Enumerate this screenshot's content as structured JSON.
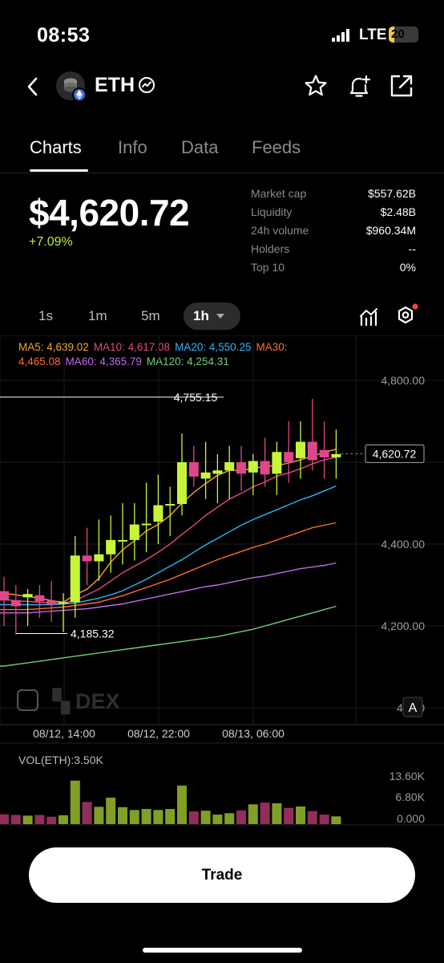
{
  "status": {
    "time": "08:53",
    "network": "LTE",
    "battery": "20"
  },
  "header": {
    "token": "ETH"
  },
  "tabs": [
    "Charts",
    "Info",
    "Data",
    "Feeds"
  ],
  "price": {
    "value": "$4,620.72",
    "change": "+7.09%"
  },
  "stats": [
    {
      "label": "Market cap",
      "value": "$557.62B"
    },
    {
      "label": "Liquidity",
      "value": "$2.48B"
    },
    {
      "label": "24h volume",
      "value": "$960.34M"
    },
    {
      "label": "Holders",
      "value": "--"
    },
    {
      "label": "Top 10",
      "value": "0%"
    }
  ],
  "intervals": [
    "1s",
    "1m",
    "5m",
    "1h"
  ],
  "colors": {
    "up": "#c6f53a",
    "down": "#e0468a",
    "ma5": "#f5a623",
    "ma10": "#e54b7c",
    "ma20": "#29b6f6",
    "ma30": "#ff6d2e",
    "ma60": "#c36ae6",
    "ma120": "#6fcf7f"
  },
  "ma_legend": {
    "ma5": "MA5: 4,639.02",
    "ma10": "MA10: 4,617.08",
    "ma20": "MA20: 4,550.25",
    "ma30_label": "MA30:",
    "ma30_value": "4,465.08",
    "ma60": "MA60: 4,365.79",
    "ma120": "MA120: 4,254.31"
  },
  "chart_data": {
    "type": "candlestick",
    "y_ticks": [
      "4,800.00",
      "4,400.00",
      "4,200.00",
      "4,000"
    ],
    "x_ticks": [
      "08/12, 14:00",
      "08/12, 22:00",
      "08/13, 06:00"
    ],
    "current_price_label": "4,620.72",
    "current_price": 4620.72,
    "high_label": "4,755.15",
    "high": 4755.15,
    "low_label": "4,185.32",
    "low": 4185.32,
    "candles": [
      {
        "o": 4285,
        "h": 4320,
        "l": 4200,
        "c": 4262
      },
      {
        "o": 4262,
        "h": 4300,
        "l": 4180,
        "c": 4248
      },
      {
        "o": 4270,
        "h": 4290,
        "l": 4200,
        "c": 4278
      },
      {
        "o": 4275,
        "h": 4300,
        "l": 4220,
        "c": 4260
      },
      {
        "o": 4262,
        "h": 4310,
        "l": 4210,
        "c": 4252
      },
      {
        "o": 4255,
        "h": 4280,
        "l": 4185,
        "c": 4258
      },
      {
        "o": 4258,
        "h": 4420,
        "l": 4220,
        "c": 4372
      },
      {
        "o": 4372,
        "h": 4440,
        "l": 4300,
        "c": 4358
      },
      {
        "o": 4358,
        "h": 4460,
        "l": 4310,
        "c": 4375
      },
      {
        "o": 4375,
        "h": 4470,
        "l": 4330,
        "c": 4410
      },
      {
        "o": 4410,
        "h": 4500,
        "l": 4350,
        "c": 4410
      },
      {
        "o": 4410,
        "h": 4500,
        "l": 4360,
        "c": 4448
      },
      {
        "o": 4450,
        "h": 4550,
        "l": 4380,
        "c": 4450
      },
      {
        "o": 4455,
        "h": 4570,
        "l": 4400,
        "c": 4495
      },
      {
        "o": 4495,
        "h": 4540,
        "l": 4420,
        "c": 4498
      },
      {
        "o": 4498,
        "h": 4670,
        "l": 4470,
        "c": 4600
      },
      {
        "o": 4600,
        "h": 4640,
        "l": 4540,
        "c": 4565
      },
      {
        "o": 4560,
        "h": 4650,
        "l": 4510,
        "c": 4575
      },
      {
        "o": 4572,
        "h": 4620,
        "l": 4500,
        "c": 4580
      },
      {
        "o": 4580,
        "h": 4640,
        "l": 4510,
        "c": 4600
      },
      {
        "o": 4600,
        "h": 4640,
        "l": 4530,
        "c": 4572
      },
      {
        "o": 4575,
        "h": 4620,
        "l": 4520,
        "c": 4603
      },
      {
        "o": 4603,
        "h": 4660,
        "l": 4540,
        "c": 4570
      },
      {
        "o": 4572,
        "h": 4650,
        "l": 4520,
        "c": 4625
      },
      {
        "o": 4625,
        "h": 4700,
        "l": 4550,
        "c": 4600
      },
      {
        "o": 4610,
        "h": 4700,
        "l": 4560,
        "c": 4650
      },
      {
        "o": 4650,
        "h": 4755,
        "l": 4580,
        "c": 4605
      },
      {
        "o": 4630,
        "h": 4700,
        "l": 4560,
        "c": 4612
      },
      {
        "o": 4612,
        "h": 4680,
        "l": 4560,
        "c": 4620
      }
    ],
    "ma_lines": [
      {
        "name": "MA5",
        "color": "#f5a623",
        "values": [
          4280,
          4276,
          4272,
          4268,
          4262,
          4258,
          4276,
          4290,
          4316,
          4356,
          4386,
          4408,
          4432,
          4448,
          4470,
          4500,
          4526,
          4548,
          4568,
          4580,
          4580,
          4585,
          4590,
          4592,
          4598,
          4606,
          4615,
          4624,
          4632
        ]
      },
      {
        "name": "MA10",
        "color": "#e54b7c",
        "values": [
          4265,
          4262,
          4260,
          4258,
          4256,
          4256,
          4262,
          4276,
          4290,
          4310,
          4330,
          4346,
          4362,
          4380,
          4400,
          4424,
          4446,
          4470,
          4490,
          4510,
          4524,
          4540,
          4552,
          4566,
          4574,
          4584,
          4596,
          4606,
          4612
        ]
      },
      {
        "name": "MA20",
        "color": "#29b6f6",
        "values": [
          4252,
          4252,
          4252,
          4252,
          4252,
          4254,
          4256,
          4262,
          4268,
          4276,
          4286,
          4300,
          4314,
          4330,
          4346,
          4362,
          4380,
          4398,
          4414,
          4430,
          4446,
          4460,
          4472,
          4484,
          4496,
          4508,
          4518,
          4530,
          4542
        ]
      },
      {
        "name": "MA30",
        "color": "#ff6d2e",
        "values": [
          4240,
          4240,
          4240,
          4242,
          4244,
          4246,
          4250,
          4254,
          4258,
          4266,
          4274,
          4284,
          4294,
          4304,
          4314,
          4326,
          4338,
          4350,
          4362,
          4372,
          4382,
          4392,
          4400,
          4410,
          4420,
          4430,
          4440,
          4446,
          4452
        ]
      },
      {
        "name": "MA60",
        "color": "#c36ae6",
        "values": [
          4232,
          4232,
          4232,
          4234,
          4236,
          4238,
          4240,
          4242,
          4246,
          4250,
          4254,
          4260,
          4266,
          4272,
          4278,
          4284,
          4290,
          4296,
          4300,
          4306,
          4312,
          4318,
          4322,
          4328,
          4334,
          4340,
          4344,
          4348,
          4354
        ]
      },
      {
        "name": "MA120",
        "color": "#6fcf7f",
        "values": [
          4102,
          4106,
          4110,
          4114,
          4118,
          4122,
          4126,
          4130,
          4134,
          4138,
          4142,
          4146,
          4150,
          4154,
          4158,
          4162,
          4166,
          4170,
          4174,
          4180,
          4186,
          4192,
          4200,
          4208,
          4216,
          4224,
          4232,
          4240,
          4248
        ]
      }
    ],
    "volume": {
      "label": "VOL(ETH):3.50K",
      "y_ticks": [
        "13.60K",
        "6.80K",
        "0.000"
      ],
      "ymax": 13600,
      "values": [
        2800,
        2600,
        2400,
        2600,
        2100,
        2500,
        12300,
        6300,
        4900,
        7500,
        4800,
        4000,
        4300,
        4000,
        4300,
        10900,
        3600,
        3800,
        2700,
        3100,
        3900,
        5600,
        6100,
        5900,
        4600,
        5000,
        3700,
        2700,
        2200
      ]
    }
  },
  "watermark": "DEX",
  "auto_scale_label": "A",
  "trade_label": "Trade"
}
